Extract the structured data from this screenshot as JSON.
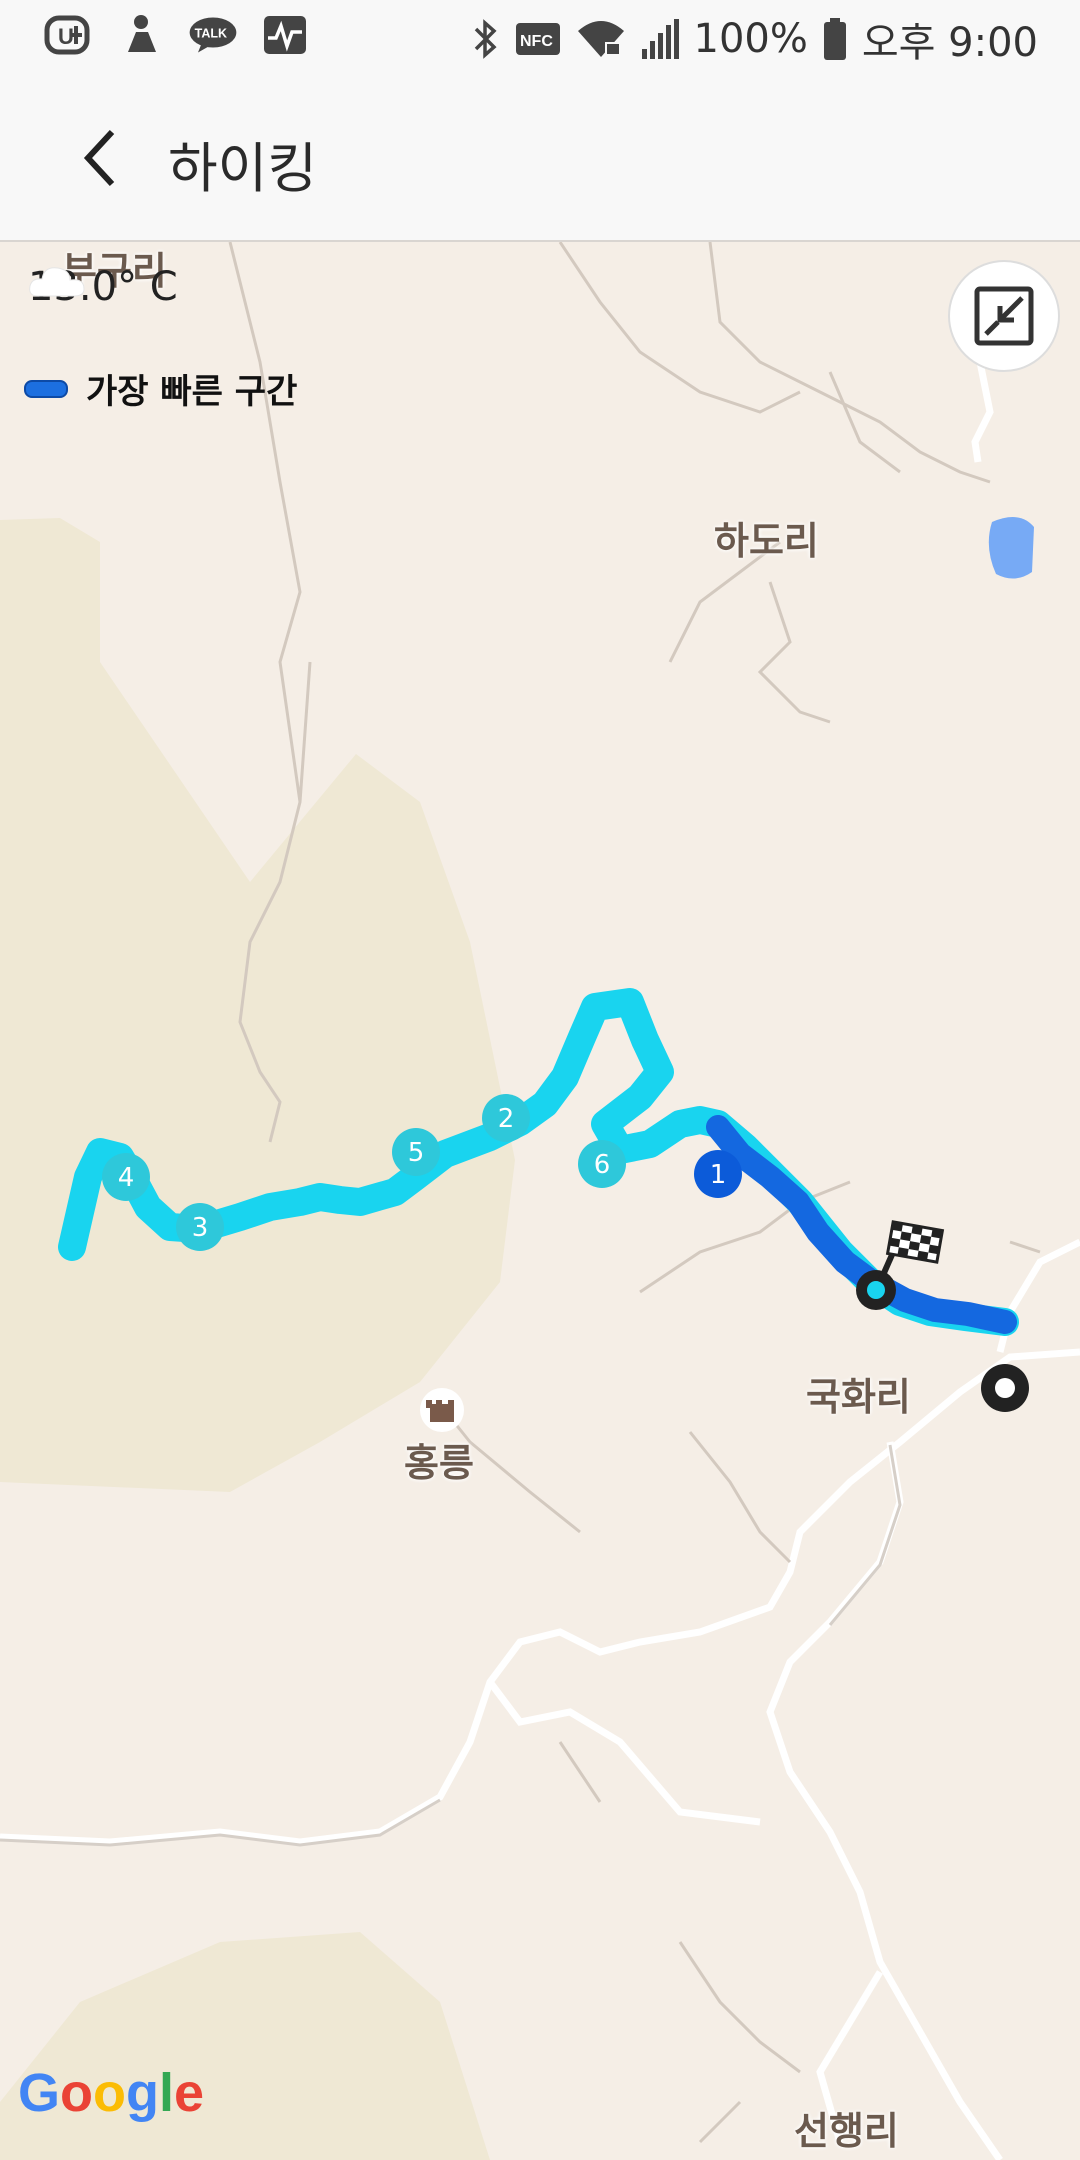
{
  "status_bar": {
    "left_icons": [
      "uplus-icon",
      "person-icon",
      "kakaotalk-icon",
      "activity-icon"
    ],
    "talk_label": "TALK",
    "nfc_label": "NFC",
    "battery_text": "100%",
    "time_text": "오후 9:00"
  },
  "app_bar": {
    "title": "하이킹"
  },
  "map": {
    "weather": {
      "icon": "cloud-icon",
      "text": "13.0° C"
    },
    "legend": {
      "label": "가장 빠른 구간",
      "color": "#1c6fe0"
    },
    "places": {
      "bugu_ri": "부구리",
      "hado_ri": "하도리",
      "gukhwa_ri": "국화리",
      "hongneung": "홍릉",
      "seonhaeng_ri": "선행리"
    },
    "markers": [
      "1",
      "2",
      "3",
      "4",
      "5",
      "6"
    ],
    "route_color_main": "#19d4ef",
    "route_color_fast": "#1468e0",
    "google_logo": "Google"
  }
}
